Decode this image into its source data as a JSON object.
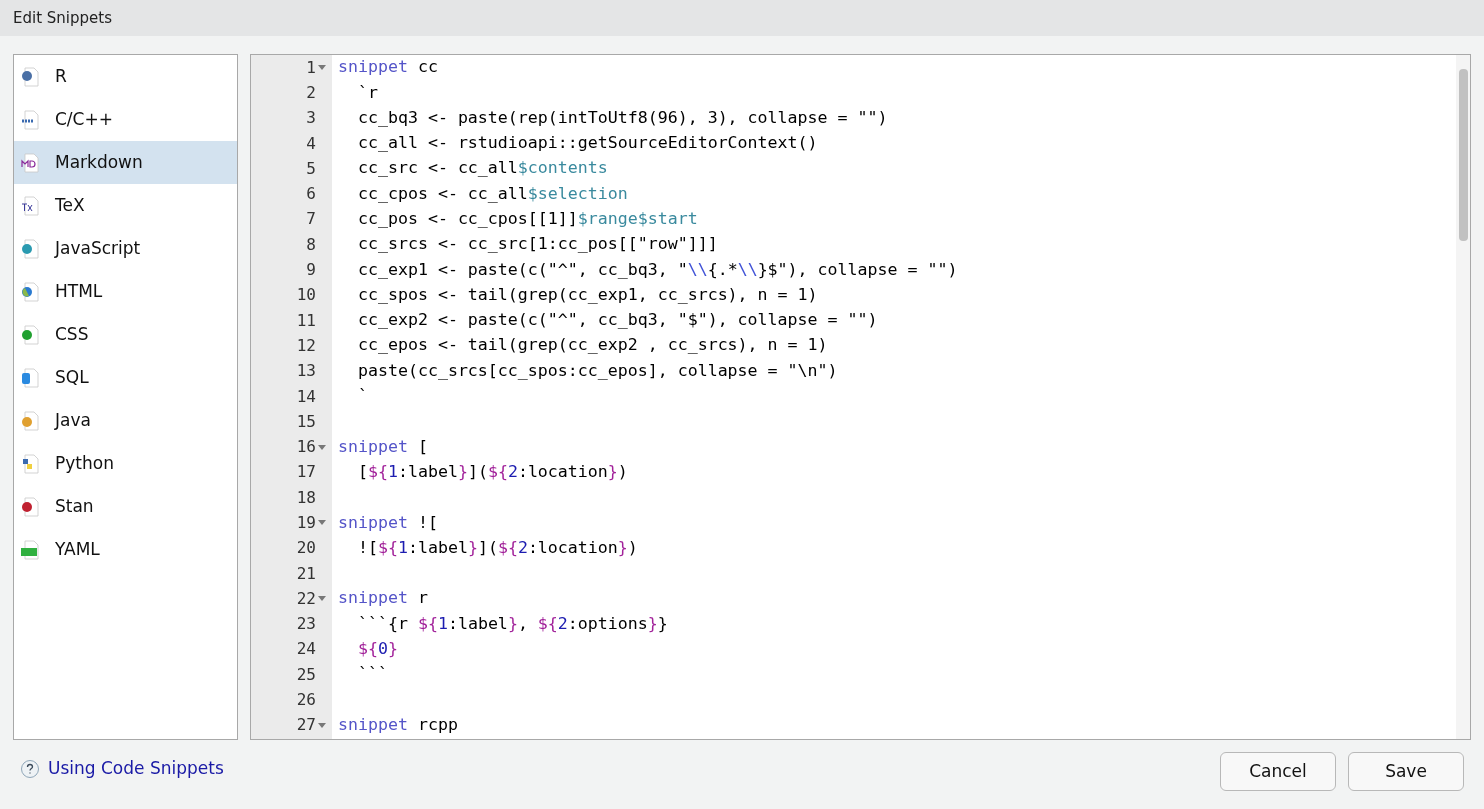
{
  "window": {
    "title": "Edit Snippets"
  },
  "languages": [
    {
      "label": "R",
      "kind": "r",
      "selected": false
    },
    {
      "label": "C/C++",
      "kind": "cpp",
      "selected": false
    },
    {
      "label": "Markdown",
      "kind": "md",
      "selected": true
    },
    {
      "label": "TeX",
      "kind": "tex",
      "selected": false
    },
    {
      "label": "JavaScript",
      "kind": "js",
      "selected": false
    },
    {
      "label": "HTML",
      "kind": "html",
      "selected": false
    },
    {
      "label": "CSS",
      "kind": "css",
      "selected": false
    },
    {
      "label": "SQL",
      "kind": "sql",
      "selected": false
    },
    {
      "label": "Java",
      "kind": "java",
      "selected": false
    },
    {
      "label": "Python",
      "kind": "python",
      "selected": false
    },
    {
      "label": "Stan",
      "kind": "stan",
      "selected": false
    },
    {
      "label": "YAML",
      "kind": "yaml",
      "selected": false
    }
  ],
  "editor": {
    "lines": [
      {
        "number": "1",
        "fold": true,
        "tokens": [
          {
            "kind": "keyword",
            "text": "snippet"
          },
          {
            "kind": "plain",
            "text": " cc"
          }
        ]
      },
      {
        "number": "2",
        "fold": false,
        "tokens": [
          {
            "kind": "plain",
            "text": "  `r"
          }
        ]
      },
      {
        "number": "3",
        "fold": false,
        "tokens": [
          {
            "kind": "plain",
            "text": "  cc_bq3 <- paste(rep(intToUtf8(96), 3), collapse = \"\")"
          }
        ]
      },
      {
        "number": "4",
        "fold": false,
        "tokens": [
          {
            "kind": "plain",
            "text": "  cc_all <- rstudioapi::getSourceEditorContext()"
          }
        ]
      },
      {
        "number": "5",
        "fold": false,
        "tokens": [
          {
            "kind": "plain",
            "text": "  cc_src <- cc_all"
          },
          {
            "kind": "field",
            "text": "$contents"
          }
        ]
      },
      {
        "number": "6",
        "fold": false,
        "tokens": [
          {
            "kind": "plain",
            "text": "  cc_cpos <- cc_all"
          },
          {
            "kind": "field",
            "text": "$selection"
          }
        ]
      },
      {
        "number": "7",
        "fold": false,
        "tokens": [
          {
            "kind": "plain",
            "text": "  cc_pos <- cc_cpos[[1]]"
          },
          {
            "kind": "field",
            "text": "$range$start"
          }
        ]
      },
      {
        "number": "8",
        "fold": false,
        "tokens": [
          {
            "kind": "plain",
            "text": "  cc_srcs <- cc_src[1:cc_pos[[\"row\"]]]"
          }
        ]
      },
      {
        "number": "9",
        "fold": false,
        "tokens": [
          {
            "kind": "plain",
            "text": "  cc_exp1 <- paste(c(\"^\", cc_bq3, \""
          },
          {
            "kind": "escape",
            "text": "\\\\"
          },
          {
            "kind": "plain",
            "text": "{.*"
          },
          {
            "kind": "escape",
            "text": "\\\\"
          },
          {
            "kind": "plain",
            "text": "}$\"), collapse = \"\")"
          }
        ]
      },
      {
        "number": "10",
        "fold": false,
        "tokens": [
          {
            "kind": "plain",
            "text": "  cc_spos <- tail(grep(cc_exp1, cc_srcs), n = 1)"
          }
        ]
      },
      {
        "number": "11",
        "fold": false,
        "tokens": [
          {
            "kind": "plain",
            "text": "  cc_exp2 <- paste(c(\"^\", cc_bq3, \"$\"), collapse = \"\")"
          }
        ]
      },
      {
        "number": "12",
        "fold": false,
        "tokens": [
          {
            "kind": "plain",
            "text": "  cc_epos <- tail(grep(cc_exp2 , cc_srcs), n = 1)"
          }
        ]
      },
      {
        "number": "13",
        "fold": false,
        "tokens": [
          {
            "kind": "plain",
            "text": "  paste(cc_srcs[cc_spos:cc_epos], collapse = \"\\n\")"
          }
        ]
      },
      {
        "number": "14",
        "fold": false,
        "tokens": [
          {
            "kind": "plain",
            "text": "  `"
          }
        ]
      },
      {
        "number": "15",
        "fold": false
      },
      {
        "number": "16",
        "fold": true,
        "tokens": [
          {
            "kind": "keyword",
            "text": "snippet"
          },
          {
            "kind": "plain",
            "text": " ["
          }
        ]
      },
      {
        "number": "17",
        "fold": false,
        "tokens": [
          {
            "kind": "plain",
            "text": "  ["
          },
          {
            "kind": "var",
            "text": "${"
          },
          {
            "kind": "number",
            "text": "1"
          },
          {
            "kind": "plain",
            "text": ":label"
          },
          {
            "kind": "var",
            "text": "}"
          },
          {
            "kind": "plain",
            "text": "]("
          },
          {
            "kind": "var",
            "text": "${"
          },
          {
            "kind": "number",
            "text": "2"
          },
          {
            "kind": "plain",
            "text": ":location"
          },
          {
            "kind": "var",
            "text": "}"
          },
          {
            "kind": "plain",
            "text": ")"
          }
        ]
      },
      {
        "number": "18",
        "fold": false
      },
      {
        "number": "19",
        "fold": true,
        "tokens": [
          {
            "kind": "keyword",
            "text": "snippet"
          },
          {
            "kind": "plain",
            "text": " !["
          }
        ]
      },
      {
        "number": "20",
        "fold": false,
        "tokens": [
          {
            "kind": "plain",
            "text": "  !["
          },
          {
            "kind": "var",
            "text": "${"
          },
          {
            "kind": "number",
            "text": "1"
          },
          {
            "kind": "plain",
            "text": ":label"
          },
          {
            "kind": "var",
            "text": "}"
          },
          {
            "kind": "plain",
            "text": "]("
          },
          {
            "kind": "var",
            "text": "${"
          },
          {
            "kind": "number",
            "text": "2"
          },
          {
            "kind": "plain",
            "text": ":location"
          },
          {
            "kind": "var",
            "text": "}"
          },
          {
            "kind": "plain",
            "text": ")"
          }
        ]
      },
      {
        "number": "21",
        "fold": false
      },
      {
        "number": "22",
        "fold": true,
        "tokens": [
          {
            "kind": "keyword",
            "text": "snippet"
          },
          {
            "kind": "plain",
            "text": " r"
          }
        ]
      },
      {
        "number": "23",
        "fold": false,
        "tokens": [
          {
            "kind": "plain",
            "text": "  ```{r "
          },
          {
            "kind": "var",
            "text": "${"
          },
          {
            "kind": "number",
            "text": "1"
          },
          {
            "kind": "plain",
            "text": ":label"
          },
          {
            "kind": "var",
            "text": "}"
          },
          {
            "kind": "plain",
            "text": ", "
          },
          {
            "kind": "var",
            "text": "${"
          },
          {
            "kind": "number",
            "text": "2"
          },
          {
            "kind": "plain",
            "text": ":options"
          },
          {
            "kind": "var",
            "text": "}"
          },
          {
            "kind": "plain",
            "text": "}"
          }
        ]
      },
      {
        "number": "24",
        "fold": false,
        "tokens": [
          {
            "kind": "var",
            "text": "  ${"
          },
          {
            "kind": "number",
            "text": "0"
          },
          {
            "kind": "var",
            "text": "}"
          }
        ]
      },
      {
        "number": "25",
        "fold": false,
        "tokens": [
          {
            "kind": "plain",
            "text": "  ```"
          }
        ]
      },
      {
        "number": "26",
        "fold": false
      },
      {
        "number": "27",
        "fold": true,
        "tokens": [
          {
            "kind": "keyword",
            "text": "snippet"
          },
          {
            "kind": "plain",
            "text": " rcpp"
          }
        ]
      }
    ]
  },
  "help_link": "Using Code Snippets",
  "buttons": [
    "Cancel",
    "Save"
  ]
}
